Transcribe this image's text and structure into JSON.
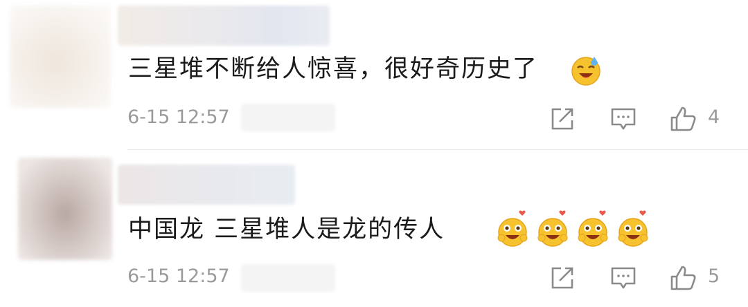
{
  "comments": [
    {
      "text": "三星堆不断给人惊喜，很好奇历史了",
      "emojis": [
        "tears-of-joy-emoji"
      ],
      "time": "6-15 12:57",
      "likes": "4"
    },
    {
      "text": "中国龙  三星堆人是龙的传人",
      "emojis": [
        "heart-eyes-emoji",
        "heart-eyes-emoji",
        "heart-eyes-emoji",
        "heart-eyes-emoji"
      ],
      "time": "6-15 12:57",
      "likes": "5"
    }
  ],
  "colors": {
    "text": "#1b1b1b",
    "meta": "#9a9a9a",
    "icon": "#8a8a8a",
    "emoji_face": "#f6c22e",
    "divider": "#e6e6e6"
  }
}
